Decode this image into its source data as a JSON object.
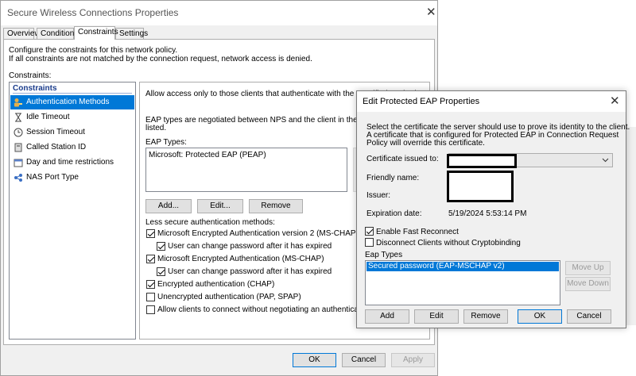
{
  "main_window": {
    "title": "Secure Wireless Connections Properties",
    "tabs": [
      "Overview",
      "Conditions",
      "Constraints",
      "Settings"
    ],
    "active_tab": "Constraints",
    "intro_line1": "Configure the constraints for this network policy.",
    "intro_line2": "If all constraints are not matched by the connection request, network access is denied.",
    "constraints_label": "Constraints:",
    "nav_header": "Constraints",
    "nav_items": [
      "Authentication Methods",
      "Idle Timeout",
      "Session Timeout",
      "Called Station ID",
      "Day and time restrictions",
      "NAS Port Type"
    ],
    "allow_text": "Allow access only to those clients that authenticate with the specified method",
    "eap_desc_line1": "EAP types are negotiated between NPS and the client in the order in whi",
    "eap_desc_line2": "listed.",
    "eap_types_label": "EAP Types:",
    "eap_list": [
      "Microsoft: Protected EAP (PEAP)"
    ],
    "buttons": {
      "add": "Add...",
      "edit": "Edit...",
      "remove": "Remove"
    },
    "less_secure_label": "Less secure authentication methods:",
    "checkboxes": [
      {
        "label": "Microsoft Encrypted Authentication version 2 (MS-CHAP-v2)",
        "checked": true
      },
      {
        "label": "User can change password after it has expired",
        "checked": true
      },
      {
        "label": "Microsoft Encrypted Authentication (MS-CHAP)",
        "checked": true
      },
      {
        "label": "User can change password after it has expired",
        "checked": true
      },
      {
        "label": "Encrypted authentication (CHAP)",
        "checked": true
      },
      {
        "label": "Unencrypted authentication (PAP, SPAP)",
        "checked": false
      },
      {
        "label": "Allow clients to connect without negotiating an authentication method",
        "checked": false
      }
    ],
    "footer": {
      "ok": "OK",
      "cancel": "Cancel",
      "apply": "Apply"
    }
  },
  "dialog": {
    "title": "Edit Protected EAP Properties",
    "desc_line1": "Select the certificate the server should use to prove its identity to the client.",
    "desc_line2": "A certificate that is configured for Protected EAP in Connection Request",
    "desc_line3": "Policy will override this certificate.",
    "cert_label": "Certificate issued to:",
    "friendly_label": "Friendly name:",
    "issuer_label": "Issuer:",
    "expiration_label": "Expiration date:",
    "expiration_value": "5/19/2024 5:53:14 PM",
    "enable_fast_reconnect": {
      "label": "Enable Fast Reconnect",
      "checked": true
    },
    "disconnect_clients": {
      "label": "Disconnect Clients without Cryptobinding",
      "checked": false
    },
    "eap_types_label": "Eap Types",
    "eap_list": [
      "Secured password (EAP-MSCHAP v2)"
    ],
    "move_up": "Move Up",
    "move_down": "Move Down",
    "buttons": {
      "add": "Add",
      "edit": "Edit",
      "remove": "Remove",
      "ok": "OK",
      "cancel": "Cancel"
    }
  },
  "colors": {
    "selection": "#0078d7",
    "nav_header": "#1a3c8c",
    "window_bg": "#f0f0f0"
  }
}
